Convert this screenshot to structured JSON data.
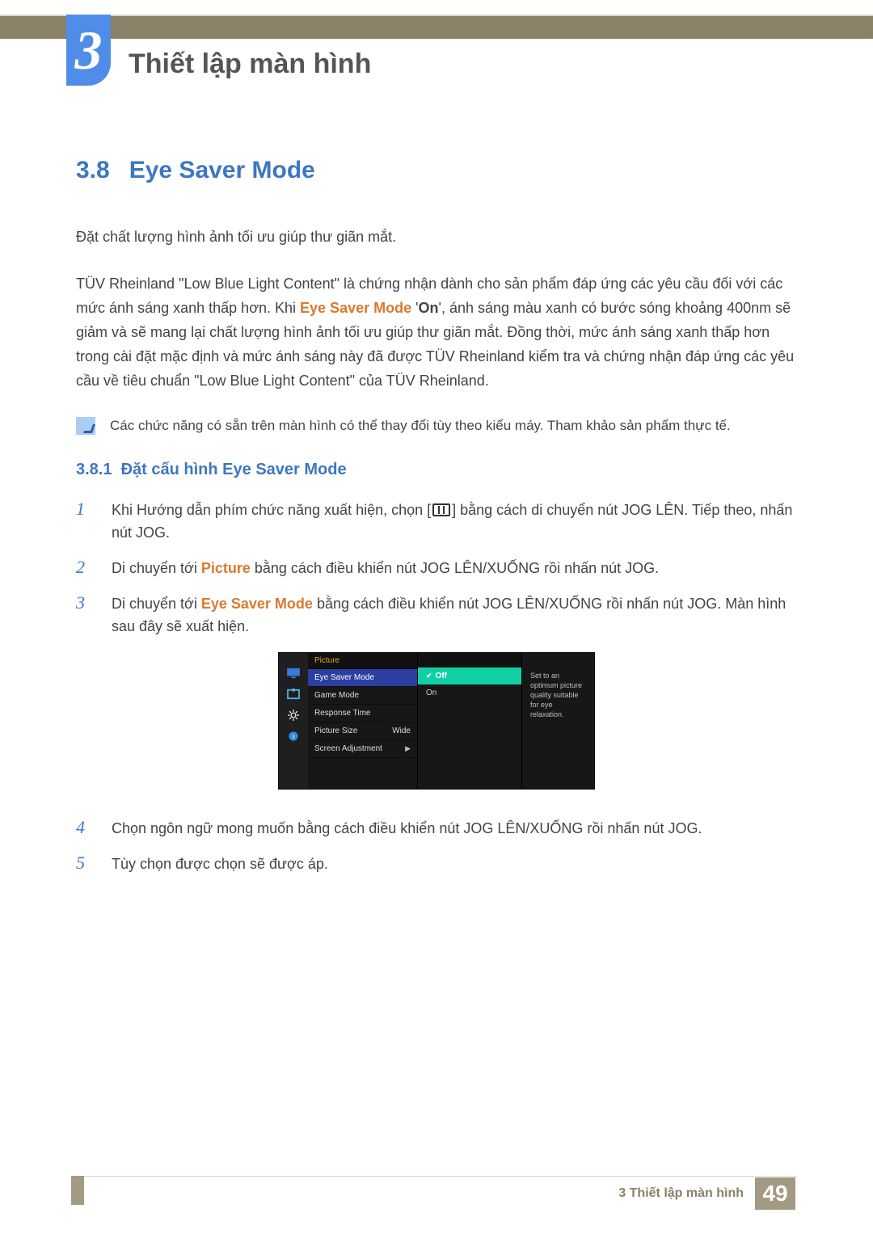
{
  "chapter": {
    "number": "3",
    "title": "Thiết lập màn hình"
  },
  "section": {
    "number": "3.8",
    "title": "Eye Saver Mode"
  },
  "intro": "Đặt chất lượng hình ảnh tối ưu giúp thư giãn mắt.",
  "body_parts": {
    "p2_a": "TÜV Rheinland \"Low Blue Light Content\" là chứng nhận dành cho sản phẩm đáp ứng các yêu cầu đối với các mức ánh sáng xanh thấp hơn. Khi ",
    "p2_b": "Eye Saver Mode",
    "p2_c": " '",
    "p2_d": "On",
    "p2_e": "', ánh sáng màu xanh có bước sóng khoảng 400nm sẽ giảm và sẽ mang lại chất lượng hình ảnh tối ưu giúp thư giãn mắt. Đồng thời, mức ánh sáng xanh thấp hơn trong cài đặt mặc định và mức ánh sáng này đã được TÜV Rheinland kiểm tra và chứng nhận đáp ứng các yêu cầu về tiêu chuẩn \"Low Blue Light Content\" của TÜV Rheinland."
  },
  "note": "Các chức năng có sẵn trên màn hình có thể thay đổi tùy theo kiểu máy. Tham khảo sản phẩm thực tế.",
  "subsection": {
    "number": "3.8.1",
    "title": "Đặt cấu hình Eye Saver Mode"
  },
  "steps": {
    "s1_a": "Khi Hướng dẫn phím chức năng xuất hiện, chọn [",
    "s1_b": "] bằng cách di chuyển nút JOG LÊN. Tiếp theo, nhấn nút JOG.",
    "s2_a": "Di chuyển tới ",
    "s2_b": "Picture",
    "s2_c": " bằng cách điều khiển nút JOG LÊN/XUỐNG rồi nhấn nút JOG.",
    "s3_a": "Di chuyển tới ",
    "s3_b": "Eye Saver Mode",
    "s3_c": " bằng cách điều khiển nút JOG LÊN/XUỐNG rồi nhấn nút JOG. Màn hình sau đây sẽ xuất hiện.",
    "s4": "Chọn ngôn ngữ mong muốn bằng cách điều khiển nút JOG LÊN/XUỐNG rồi nhấn nút JOG.",
    "s5": "Tùy chọn được chọn sẽ được áp."
  },
  "osd": {
    "title": "Picture",
    "items": [
      "Eye Saver Mode",
      "Game Mode",
      "Response Time",
      "Picture Size",
      "Screen Adjustment"
    ],
    "picture_size_value": "Wide",
    "options": [
      "Off",
      "On"
    ],
    "desc": "Set to an optimum picture quality suitable for eye relaxation."
  },
  "footer": {
    "label": "3 Thiết lập màn hình",
    "page": "49"
  }
}
